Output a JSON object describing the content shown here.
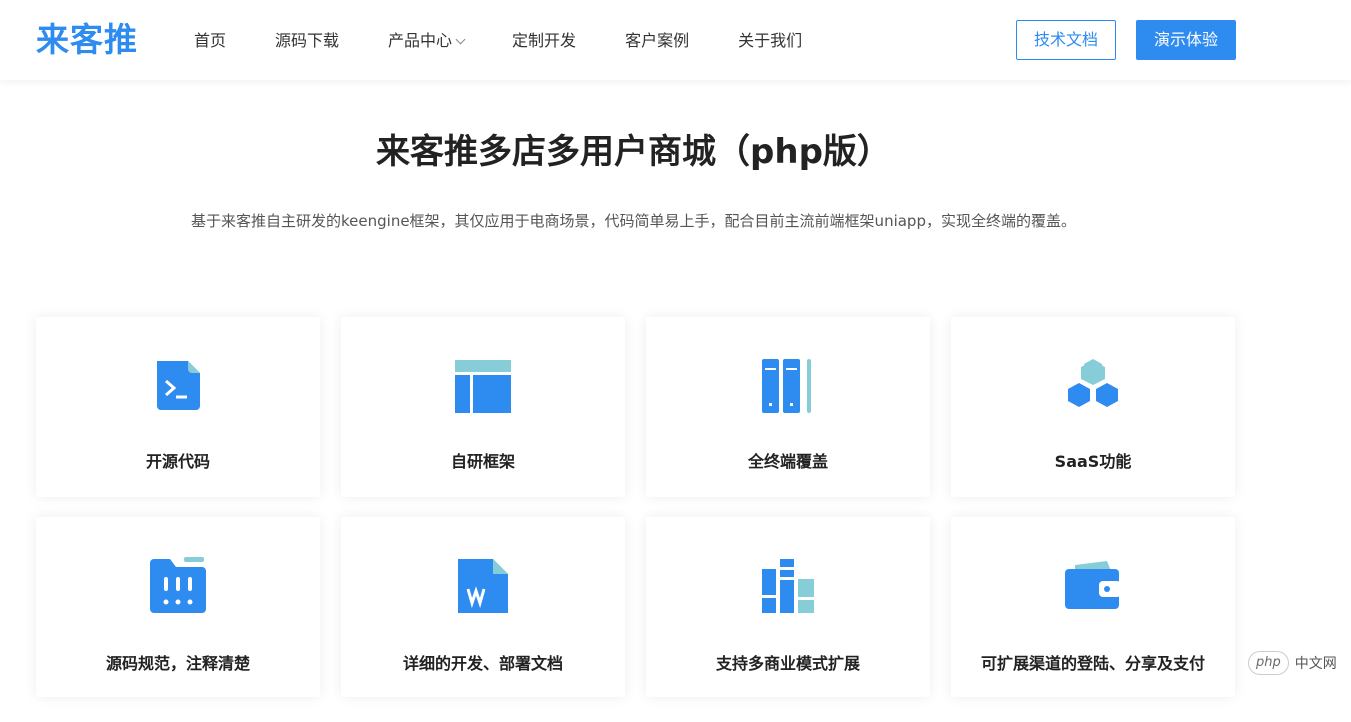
{
  "header": {
    "logo": "来客推",
    "nav": [
      "首页",
      "源码下载",
      "产品中心",
      "定制开发",
      "客户案例",
      "关于我们"
    ],
    "doc_button": "技术文档",
    "demo_button": "演示体验"
  },
  "hero": {
    "title": "来客推多店多用户商城（php版）",
    "subtitle": "基于来客推自主研发的keengine框架，其仅应用于电商场景，代码简单易上手，配合目前主流前端框架uniapp，实现全终端的覆盖。"
  },
  "features": [
    {
      "label": "开源代码",
      "icon": "code-file-icon"
    },
    {
      "label": "自研框架",
      "icon": "layout-icon"
    },
    {
      "label": "全终端覆盖",
      "icon": "devices-icon"
    },
    {
      "label": "SaaS功能",
      "icon": "hexagons-icon"
    },
    {
      "label": "源码规范，注释清楚",
      "icon": "folder-dots-icon"
    },
    {
      "label": "详细的开发、部署文档",
      "icon": "word-doc-icon"
    },
    {
      "label": "支持多商业模式扩展",
      "icon": "books-icon"
    },
    {
      "label": "可扩展渠道的登陆、分享及支付",
      "icon": "wallet-icon"
    }
  ],
  "watermark": {
    "pill": "php",
    "text": "中文网"
  },
  "colors": {
    "primary": "#2e8bf0",
    "accent": "#86cdd8"
  }
}
